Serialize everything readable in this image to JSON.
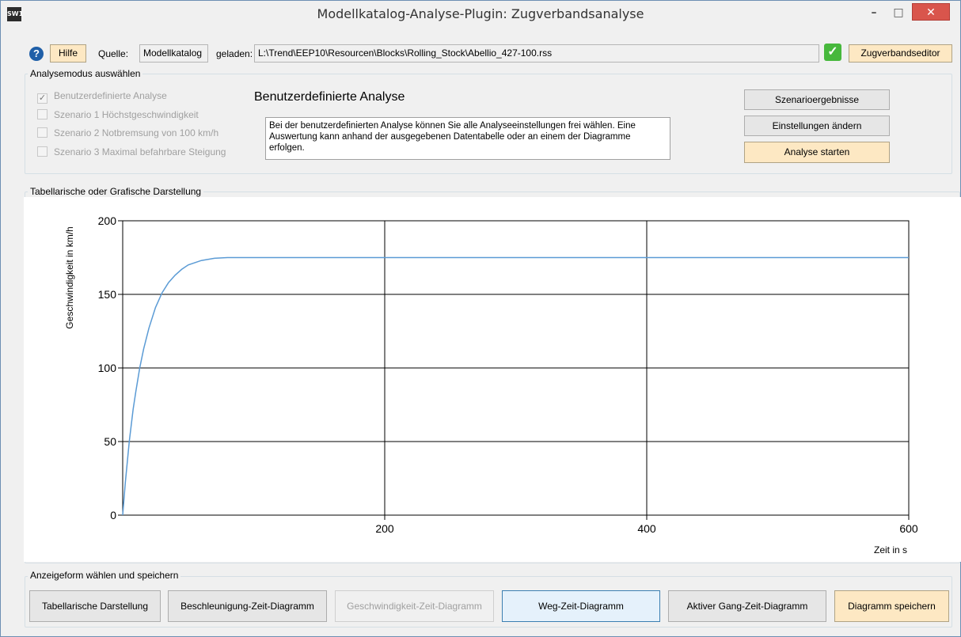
{
  "window": {
    "title": "Modellkatalog-Analyse-Plugin: Zugverbandsanalyse",
    "app_icon_text": "SW1",
    "minimize_glyph": "–",
    "maximize_glyph": "□",
    "close_glyph": "✕"
  },
  "toolbar": {
    "help_icon_glyph": "?",
    "help_label": "Hilfe",
    "source_label": "Quelle:",
    "source_value": "Modellkatalog",
    "loaded_label": "geladen:",
    "loaded_path": "L:\\Trend\\EEP10\\Resourcen\\Blocks\\Rolling_Stock\\Abellio_427-100.rss",
    "status_icon": "check-icon",
    "status_glyph": "✓",
    "editor_label": "Zugverbandseditor"
  },
  "analysis_mode": {
    "group_title": "Analysemodus auswählen",
    "options": [
      {
        "label": "Benutzerdefinierte Analyse",
        "checked": true
      },
      {
        "label": "Szenario 1 Höchstgeschwindigkeit",
        "checked": false
      },
      {
        "label": "Szenario 2 Notbremsung von 100 km/h",
        "checked": false
      },
      {
        "label": "Szenario 3 Maximal befahrbare Steigung",
        "checked": false
      }
    ],
    "heading": "Benutzerdefinierte Analyse",
    "description": "Bei der benutzerdefinierten Analyse können Sie alle Analyseeinstellungen frei wählen. Eine Auswertung kann anhand der ausgegebenen Datentabelle oder an einem der Diagramme erfolgen.",
    "buttons": {
      "results": "Szenarioergebnisse",
      "settings": "Einstellungen ändern",
      "start": "Analyse starten"
    }
  },
  "display": {
    "group_title": "Tabellarische oder Grafische Darstellung"
  },
  "chart_data": {
    "type": "line",
    "title": "",
    "xlabel": "Zeit in s",
    "ylabel": "Geschwindigkeit in km/h",
    "xlim": [
      0,
      600
    ],
    "ylim": [
      0,
      200
    ],
    "x_ticks": [
      200,
      400,
      600
    ],
    "y_ticks": [
      0,
      50,
      100,
      150,
      200
    ],
    "grid": true,
    "line_color": "#5b9bd5",
    "series": [
      {
        "x": [
          0,
          2,
          5,
          8,
          10,
          13,
          16,
          20,
          25,
          30,
          35,
          40,
          45,
          50,
          60,
          70,
          80,
          100,
          120,
          150,
          200,
          300,
          400,
          500,
          600
        ],
        "y": [
          0,
          22,
          50,
          72,
          84,
          100,
          113,
          127,
          141,
          151,
          158,
          163,
          167,
          170,
          173,
          174.5,
          175,
          175,
          175,
          175,
          175,
          175,
          175,
          175,
          175
        ]
      }
    ]
  },
  "footer": {
    "group_title": "Anzeigeform wählen und speichern",
    "buttons": {
      "table": "Tabellarische Darstellung",
      "accel": "Beschleunigung-Zeit-Diagramm",
      "speed": "Geschwindigkeit-Zeit-Diagramm",
      "distance": "Weg-Zeit-Diagramm",
      "gear": "Aktiver Gang-Zeit-Diagramm",
      "save": "Diagramm speichern"
    }
  }
}
